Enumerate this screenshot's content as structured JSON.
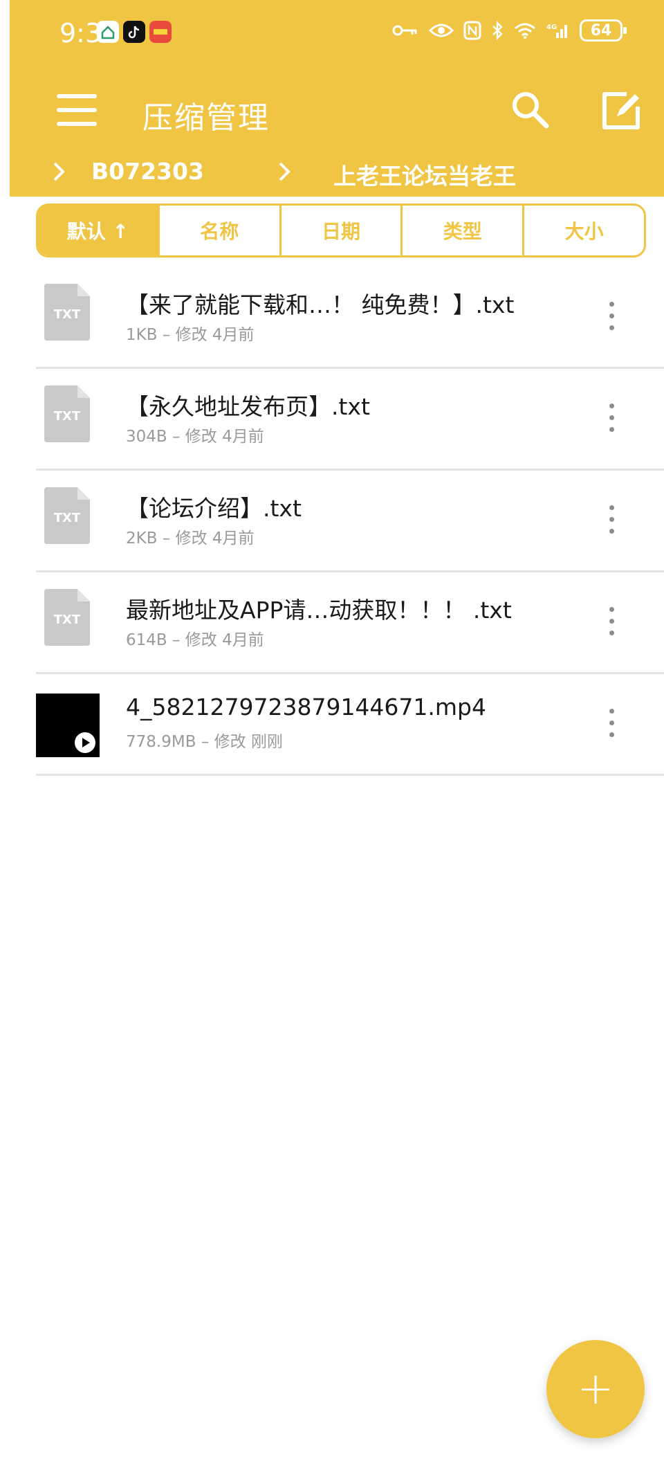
{
  "status_bar": {
    "time": "9:32",
    "battery": "64",
    "network": "4G"
  },
  "toolbar": {
    "title": "压缩管理"
  },
  "breadcrumb": [
    "B072303",
    "上老王论坛当老王"
  ],
  "sort_tabs": [
    {
      "label": "默认 ↑",
      "active": true
    },
    {
      "label": "名称",
      "active": false
    },
    {
      "label": "日期",
      "active": false
    },
    {
      "label": "类型",
      "active": false
    },
    {
      "label": "大小",
      "active": false
    }
  ],
  "files": [
    {
      "name": "【来了就能下载和…！ 纯免费！】.txt",
      "meta": "1KB – 修改 4月前",
      "type": "txt",
      "icon_label": "TXT"
    },
    {
      "name": "【永久地址发布页】.txt",
      "meta": "304B – 修改 4月前",
      "type": "txt",
      "icon_label": "TXT"
    },
    {
      "name": "【论坛介绍】.txt",
      "meta": "2KB – 修改 4月前",
      "type": "txt",
      "icon_label": "TXT"
    },
    {
      "name": "最新地址及APP请…动获取！！！ .txt",
      "meta": "614B – 修改 4月前",
      "type": "txt",
      "icon_label": "TXT"
    },
    {
      "name": "4_5821279723879144671.mp4",
      "meta": "778.9MB – 修改 刚刚",
      "type": "video"
    }
  ],
  "fab": {
    "label": "+"
  },
  "colors": {
    "accent": "#efc543",
    "text": "#1a1a1a",
    "meta": "#9a9a9a",
    "divider": "#e4e4e4"
  }
}
